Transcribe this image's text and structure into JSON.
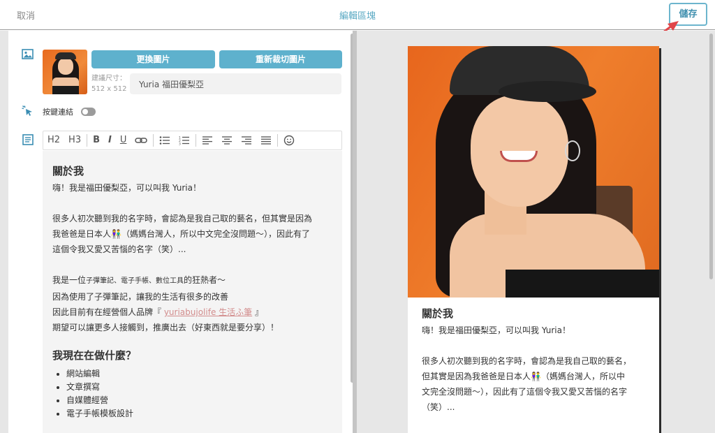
{
  "topbar": {
    "cancel_label": "取消",
    "title": "編輯區塊",
    "save_label": "儲存"
  },
  "image_block": {
    "replace_label": "更換圖片",
    "recrop_label": "重新裁切圖片",
    "size_hint_label": "建議尺寸：",
    "size_hint_value": "512 x 512",
    "alt_value": "Yuria 福田優梨亞"
  },
  "link_block": {
    "label": "按鍵連結",
    "enabled": false
  },
  "toolbar": {
    "h2": "H2",
    "h3": "H3",
    "bold": "B",
    "italic": "I",
    "underline": "U"
  },
  "editor": {
    "heading1": "關於我",
    "intro": "嗨！我是福田優梨亞，可以叫我 Yuria！",
    "para1_line1": "很多人初次聽到我的名字時，會認為是我自己取的藝名，但其實是因為",
    "para1_line2": "我爸爸是日本人👫（媽媽台灣人，所以中文完全沒問題～），因此有了",
    "para1_line3": "這個令我又愛又苦惱的名字（笑）...",
    "para2_line1_a": "我是一位",
    "para2_line1_b": "子彈筆記、電子手帳、數位工具",
    "para2_line1_c": "的狂熱者～",
    "para2_line2": "因為使用了子彈筆記，讓我的生活有很多的改善",
    "para2_line3_a": "因此目前有在經營個人品牌『 ",
    "para2_line3_link": "yuriabujolife 生活ふ筆",
    "para2_line3_b": " 』",
    "para2_line4": "期望可以讓更多人接觸到，推廣出去（好東西就是要分享）！",
    "heading2": "我現在在做什麼？",
    "list": [
      "網站編輯",
      "文章撰寫",
      "自媒體經營",
      "電子手帳模板設計"
    ]
  },
  "preview": {
    "heading": "關於我",
    "intro": "嗨！我是福田優梨亞，可以叫我 Yuria！",
    "para1_line1": "很多人初次聽到我的名字時，會認為是我自己取的藝名，",
    "para1_line2": "但其實是因為我爸爸是日本人👫（媽媽台灣人，所以中",
    "para1_line3": "文完全沒問題～），因此有了這個令我又愛又苦惱的名字",
    "para1_line4": "（笑）..."
  },
  "colors": {
    "accent": "#5eb1cd",
    "title_text": "#5aa9c3",
    "link_text": "#d28c8c",
    "arrow": "#e0464a"
  }
}
